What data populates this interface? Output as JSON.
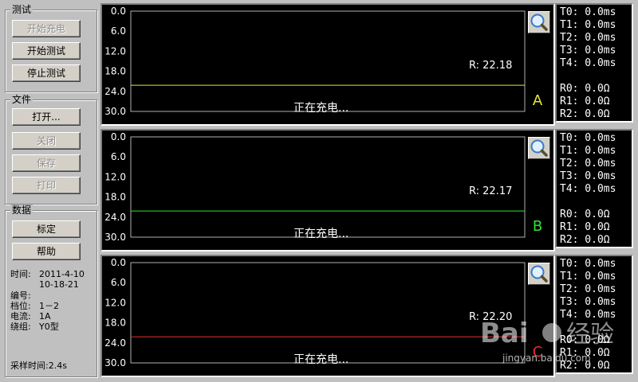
{
  "groups": {
    "test": {
      "title": "测试",
      "buttons": [
        "开始充电",
        "开始测试",
        "停止测试"
      ]
    },
    "file": {
      "title": "文件",
      "buttons": [
        "打开...",
        "关闭",
        "保存",
        "打印"
      ]
    },
    "data": {
      "title": "数据",
      "buttons": [
        "标定",
        "帮助"
      ],
      "fields": [
        {
          "key": "时间:",
          "value": "2011-4-10"
        },
        {
          "key": "",
          "value": "10-18-21"
        },
        {
          "key": "编号:",
          "value": ""
        },
        {
          "key": "档位:",
          "value": "1－2"
        },
        {
          "key": "电流:",
          "value": "1A"
        },
        {
          "key": "绕组:",
          "value": "Y0型"
        }
      ],
      "sample_time": "采样时间:2.4s"
    }
  },
  "chart_data": [
    {
      "type": "line",
      "channel": "A",
      "color": "#e6e62e",
      "y_ticks": [
        "0.0",
        "6.0",
        "12.0",
        "18.0",
        "24.0",
        "30.0"
      ],
      "ylim": [
        0,
        30
      ],
      "series": [
        {
          "values": [
            22.18
          ]
        }
      ],
      "r_label": "R: 22.18",
      "status": "正在充电..."
    },
    {
      "type": "line",
      "channel": "B",
      "color": "#2ee62e",
      "y_ticks": [
        "0.0",
        "6.0",
        "12.0",
        "18.0",
        "24.0",
        "30.0"
      ],
      "ylim": [
        0,
        30
      ],
      "series": [
        {
          "values": [
            22.17
          ]
        }
      ],
      "r_label": "R: 22.17",
      "status": "正在充电..."
    },
    {
      "type": "line",
      "channel": "C",
      "color": "#e62e2e",
      "y_ticks": [
        "0.0",
        "6.0",
        "12.0",
        "18.0",
        "24.0",
        "30.0"
      ],
      "ylim": [
        0,
        30
      ],
      "series": [
        {
          "values": [
            22.2
          ]
        }
      ],
      "r_label": "R: 22.20",
      "status": "正在充电..."
    }
  ],
  "timing": [
    {
      "t": [
        "T0: 0.0ms",
        "T1: 0.0ms",
        "T2: 0.0ms",
        "T3: 0.0ms",
        "T4: 0.0ms"
      ],
      "r": [
        "R0: 0.0Ω",
        "R1: 0.0Ω",
        "R2: 0.0Ω"
      ]
    },
    {
      "t": [
        "T0: 0.0ms",
        "T1: 0.0ms",
        "T2: 0.0ms",
        "T3: 0.0ms",
        "T4: 0.0ms"
      ],
      "r": [
        "R0: 0.0Ω",
        "R1: 0.0Ω",
        "R2: 0.0Ω"
      ]
    },
    {
      "t": [
        "T0: 0.0ms",
        "T1: 0.0ms",
        "T2: 0.0ms",
        "T3: 0.0ms",
        "T4: 0.0ms"
      ],
      "r": [
        "R0: 0.0Ω",
        "R1: 0.0Ω",
        "R2: 0.0Ω"
      ]
    }
  ],
  "icons": {
    "zoom": "magnifier-icon"
  },
  "watermark": {
    "site": "jingyan.baidu.com",
    "brand": "Baidu经验"
  }
}
